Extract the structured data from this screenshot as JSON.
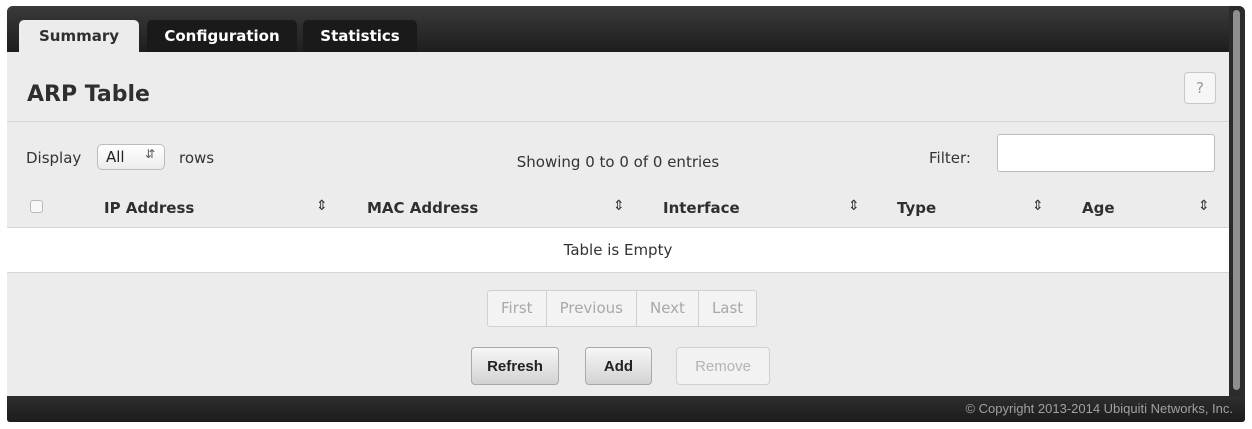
{
  "tabs": [
    {
      "label": "Summary",
      "active": true
    },
    {
      "label": "Configuration",
      "active": false
    },
    {
      "label": "Statistics",
      "active": false
    }
  ],
  "page": {
    "title": "ARP Table",
    "help_label": "?"
  },
  "controls": {
    "display_label": "Display",
    "display_value": "All",
    "rows_label": "rows",
    "showing_text": "Showing 0 to 0 of 0 entries",
    "filter_label": "Filter:",
    "filter_value": ""
  },
  "table": {
    "columns": [
      "IP Address",
      "MAC Address",
      "Interface",
      "Type",
      "Age"
    ],
    "empty_text": "Table is Empty"
  },
  "pagination": [
    "First",
    "Previous",
    "Next",
    "Last"
  ],
  "buttons": {
    "refresh": "Refresh",
    "add": "Add",
    "remove": "Remove"
  },
  "footer": {
    "copyright": "© Copyright 2013-2014 Ubiquiti Networks, Inc."
  }
}
